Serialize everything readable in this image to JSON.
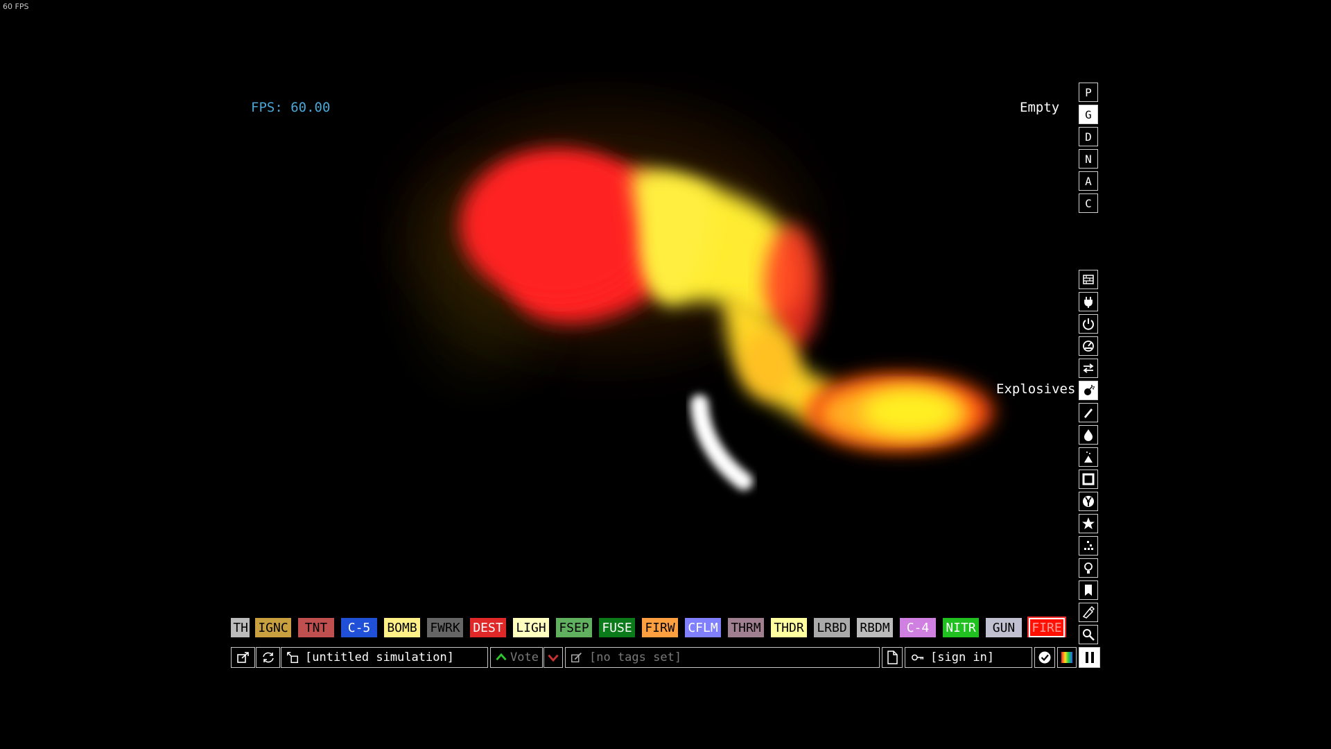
{
  "window_fps": "60 FPS",
  "sim": {
    "fps_label": "FPS: 60.00",
    "hover_element": "Empty",
    "category_tooltip": "Explosives"
  },
  "display_modes": [
    {
      "label": "P",
      "selected": false
    },
    {
      "label": "G",
      "selected": true
    },
    {
      "label": "D",
      "selected": false
    },
    {
      "label": "N",
      "selected": false
    },
    {
      "label": "A",
      "selected": false
    },
    {
      "label": "C",
      "selected": false
    }
  ],
  "categories": [
    {
      "name": "walls-icon"
    },
    {
      "name": "electronics-icon"
    },
    {
      "name": "powered-icon"
    },
    {
      "name": "sensors-icon"
    },
    {
      "name": "force-icon"
    },
    {
      "name": "explosives-icon",
      "selected": true
    },
    {
      "name": "gases-icon"
    },
    {
      "name": "liquids-icon"
    },
    {
      "name": "powders-icon"
    },
    {
      "name": "solids-icon"
    },
    {
      "name": "radioactive-icon"
    },
    {
      "name": "special-icon"
    },
    {
      "name": "life-icon"
    },
    {
      "name": "tools-icon"
    },
    {
      "name": "favorites-icon"
    },
    {
      "name": "decoration-icon"
    },
    {
      "name": "search-icon"
    }
  ],
  "elements": [
    {
      "label": "TH",
      "bg": "#bbbbbb",
      "fg": "#000000"
    },
    {
      "label": "IGNC",
      "bg": "#c8a040",
      "fg": "#000000"
    },
    {
      "label": "TNT",
      "bg": "#c05050",
      "fg": "#000000"
    },
    {
      "label": "C-5",
      "bg": "#2050d8",
      "fg": "#ffffff"
    },
    {
      "label": "BOMB",
      "bg": "#fff088",
      "fg": "#000000"
    },
    {
      "label": "FWRK",
      "bg": "#666666",
      "fg": "#000000"
    },
    {
      "label": "DEST",
      "bg": "#e02828",
      "fg": "#ffffff"
    },
    {
      "label": "LIGH",
      "bg": "#ffffc0",
      "fg": "#000000"
    },
    {
      "label": "FSEP",
      "bg": "#60b060",
      "fg": "#000000"
    },
    {
      "label": "FUSE",
      "bg": "#0a7a1a",
      "fg": "#ffffff"
    },
    {
      "label": "FIRW",
      "bg": "#ffa040",
      "fg": "#000000"
    },
    {
      "label": "CFLM",
      "bg": "#8080ff",
      "fg": "#ffffff"
    },
    {
      "label": "THRM",
      "bg": "#a08090",
      "fg": "#000000"
    },
    {
      "label": "THDR",
      "bg": "#ffffa0",
      "fg": "#000000"
    },
    {
      "label": "LRBD",
      "bg": "#aaaaaa",
      "fg": "#000000"
    },
    {
      "label": "RBDM",
      "bg": "#bbbbbb",
      "fg": "#000000"
    },
    {
      "label": "C-4",
      "bg": "#d080e0",
      "fg": "#ffffff"
    },
    {
      "label": "NITR",
      "bg": "#20c020",
      "fg": "#ffffff"
    },
    {
      "label": "GUN",
      "bg": "#c0c0d0",
      "fg": "#000000"
    },
    {
      "label": "FIRE",
      "bg": "#ff1000",
      "fg": "#ffa0a0",
      "selected": true
    }
  ],
  "toolbar": {
    "open_icon": "open-save-icon",
    "reload_icon": "reload-icon",
    "save_title": "[untitled simulation]",
    "vote_label": "Vote",
    "tags_text": "[no tags set]",
    "new_icon": "new-simulation-icon",
    "signin_label": "[sign in]",
    "settings_icon": "settings-icon",
    "render_icon": "render-options-icon",
    "pause_icon": "pause-icon"
  },
  "colors": {
    "accent_blue": "#4aa8d8",
    "vote_green": "#2ec52e",
    "downvote_red": "#c83232",
    "fire_red": "#ff2a1a",
    "fire_yellow": "#ffee30"
  }
}
